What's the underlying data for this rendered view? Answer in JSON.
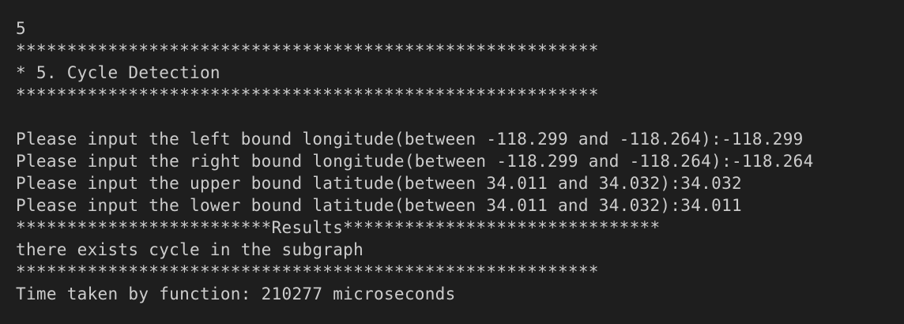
{
  "terminal": {
    "lines": [
      "5",
      "*********************************************************",
      "* 5. Cycle Detection",
      "*********************************************************",
      "",
      "Please input the left bound longitude(between -118.299 and -118.264):-118.299",
      "Please input the right bound longitude(between -118.299 and -118.264):-118.264",
      "Please input the upper bound latitude(between 34.011 and 34.032):34.032",
      "Please input the lower bound latitude(between 34.011 and 34.032):34.011",
      "*************************Results*******************************",
      "there exists cycle in the subgraph",
      "*********************************************************",
      "Time taken by function: 210277 microseconds"
    ]
  },
  "colors": {
    "background": "#1e1e1e",
    "text": "#cccccc"
  }
}
